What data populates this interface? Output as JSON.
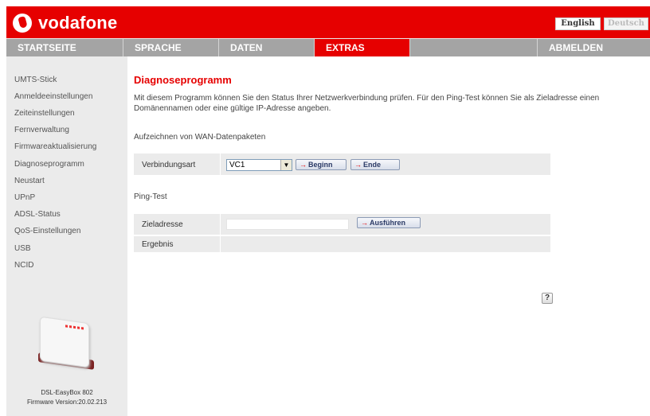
{
  "header": {
    "brand": "vodafone",
    "lang_english": "English",
    "lang_deutsch": "Deutsch",
    "brand_color": "#e60000"
  },
  "nav": {
    "items": [
      {
        "label": "STARTSEITE"
      },
      {
        "label": "SPRACHE"
      },
      {
        "label": "DATEN"
      },
      {
        "label": "EXTRAS",
        "active": true
      },
      {
        "label": "ABMELDEN"
      }
    ]
  },
  "sidebar": {
    "items": [
      {
        "label": "UMTS-Stick"
      },
      {
        "label": "Anmeldeeinstellungen"
      },
      {
        "label": "Zeiteinstellungen"
      },
      {
        "label": "Fernverwaltung"
      },
      {
        "label": "Firmwareaktualisierung"
      },
      {
        "label": "Diagnoseprogramm"
      },
      {
        "label": "Neustart"
      },
      {
        "label": "UPnP"
      },
      {
        "label": "ADSL-Status"
      },
      {
        "label": "QoS-Einstellungen"
      },
      {
        "label": "USB"
      },
      {
        "label": "NCID"
      }
    ],
    "device_name": "DSL-EasyBox 802",
    "firmware": "Firmware Version:20.02.213"
  },
  "main": {
    "title": "Diagnoseprogramm",
    "intro": "Mit diesem Programm können Sie den Status Ihrer Netzwerkverbindung prüfen. Für den Ping-Test können Sie als Zieladresse einen Domänennamen oder eine gültige IP-Adresse angeben.",
    "wan_section": "Aufzeichnen von WAN-Datenpaketen",
    "verbindungsart_label": "Verbindungsart",
    "verbindungsart_value": "VC1",
    "begin_label": "Beginn",
    "end_label": "Ende",
    "ping_section": "Ping-Test",
    "zieladresse_label": "Zieladresse",
    "zieladresse_value": "",
    "execute_label": "Ausführen",
    "ergebnis_label": "Ergebnis",
    "help_label": "?"
  }
}
